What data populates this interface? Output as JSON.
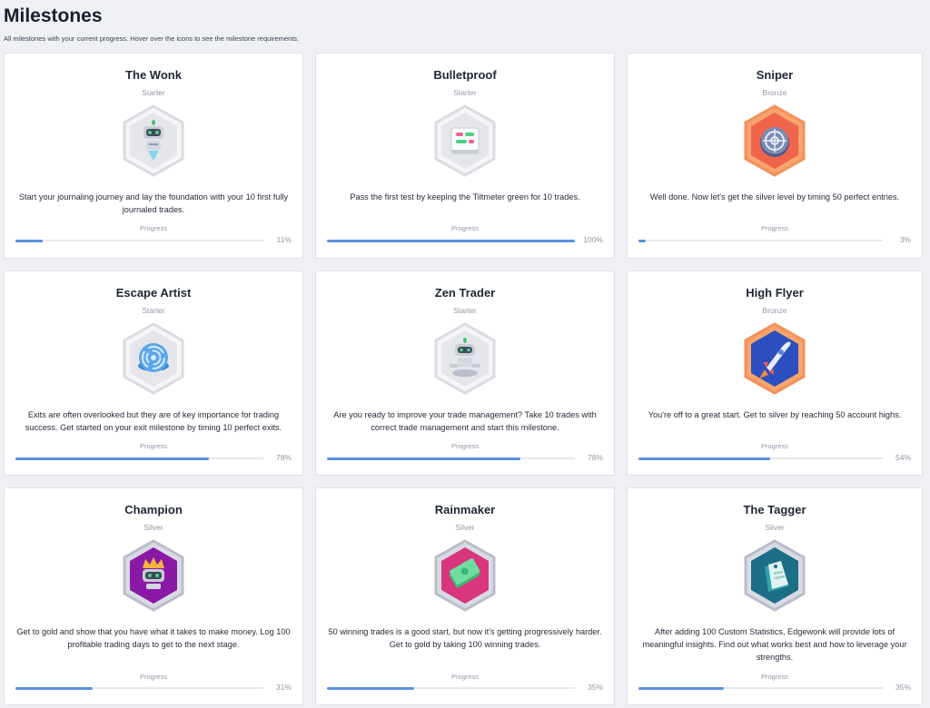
{
  "page": {
    "title": "Milestones",
    "subtitle": "All milestones with your current progress. Hover over the icons to see the milestone requirements."
  },
  "milestones": [
    {
      "title": "The Wonk",
      "tier": "Starter",
      "badge": "robot-icon",
      "description": "Start your journaling journey and lay the foundation with your 10 first fully journaled trades.",
      "progress_label": "Progress",
      "progress": 0.11,
      "percent_text": "11%"
    },
    {
      "title": "Bulletproof",
      "tier": "Starter",
      "badge": "tiltmeter-icon",
      "description": "Pass the first test by keeping the Tiltmeter green for 10 trades.",
      "progress_label": "Progress",
      "progress": 1.0,
      "percent_text": "100%"
    },
    {
      "title": "Sniper",
      "tier": "Bronze",
      "badge": "crosshair-icon",
      "description": "Well done. Now let's get the silver level by timing 50 perfect entries.",
      "progress_label": "Progress",
      "progress": 0.03,
      "percent_text": "3%"
    },
    {
      "title": "Escape Artist",
      "tier": "Starter",
      "badge": "maze-icon",
      "description": "Exits are often overlooked but they are of key importance for trading success. Get started on your exit milestone by timing 10 perfect exits.",
      "progress_label": "Progress",
      "progress": 0.78,
      "percent_text": "78%"
    },
    {
      "title": "Zen Trader",
      "tier": "Starter",
      "badge": "meditating-robot-icon",
      "description": "Are you ready to improve your trade management? Take 10 trades with correct trade management and start this milestone.",
      "progress_label": "Progress",
      "progress": 0.78,
      "percent_text": "78%"
    },
    {
      "title": "High Flyer",
      "tier": "Bronze",
      "badge": "rocket-icon",
      "description": "You're off to a great start. Get to silver by reaching 50 account highs.",
      "progress_label": "Progress",
      "progress": 0.54,
      "percent_text": "54%"
    },
    {
      "title": "Champion",
      "tier": "Silver",
      "badge": "crowned-robot-icon",
      "description": "Get to gold and show that you have what it takes to make money. Log 100 profitable trading days to get to the next stage.",
      "progress_label": "Progress",
      "progress": 0.31,
      "percent_text": "31%"
    },
    {
      "title": "Rainmaker",
      "tier": "Silver",
      "badge": "money-icon",
      "description": "50 winning trades is a good start, but now it's getting progressively harder. Get to gold by taking 100 winning trades.",
      "progress_label": "Progress",
      "progress": 0.35,
      "percent_text": "35%"
    },
    {
      "title": "The Tagger",
      "tier": "Silver",
      "badge": "tag-icon",
      "description": "After adding 100 Custom Statistics, Edgewonk will provide lots of meaningful insights. Find out what works best and how to leverage your strengths.",
      "progress_label": "Progress",
      "progress": 0.35,
      "percent_text": "35%"
    }
  ],
  "colors": {
    "progress_fill": "#5b90de",
    "starter_hex": "#e7e8eb",
    "bronze_hex": "#f0704f",
    "bronze_alt_hex": "#2f55c8",
    "silver_purple": "#8a1aa6",
    "silver_pink": "#d9357c",
    "silver_teal": "#1c6e86"
  }
}
